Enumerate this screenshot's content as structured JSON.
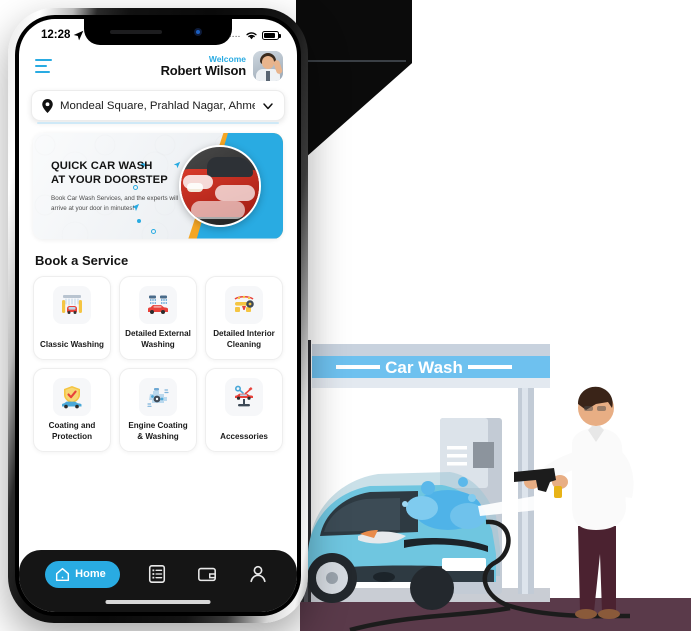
{
  "status_bar": {
    "time": "12:28",
    "location_arrow_icon": "location-arrow-icon",
    "signal_dots": "....",
    "wifi_icon": "wifi-icon",
    "battery_icon": "battery-icon"
  },
  "header": {
    "menu_icon": "hamburger-menu-icon",
    "welcome_label": "Welcome",
    "user_name": "Robert Wilson",
    "avatar_icon": "user-avatar"
  },
  "location": {
    "pin_icon": "map-pin-icon",
    "value": "Mondeal Square, Prahlad Nagar, Ahme...",
    "chevron_icon": "chevron-down-icon"
  },
  "banner": {
    "title_line1": "QUICK CAR WASH",
    "title_line2": "AT YOUR DOORSTEP",
    "subtitle": "Book Car Wash Services, and the experts will arrive at your door in minutes!",
    "photo_icon": "red-car-foam-photo",
    "accent_orange": "#F5A623",
    "accent_blue": "#29ABE2"
  },
  "services": {
    "section_title": "Book a Service",
    "items": [
      {
        "label": "Classic Washing",
        "icon": "car-wash-tunnel-icon"
      },
      {
        "label": "Detailed External Washing",
        "icon": "car-external-wash-icon"
      },
      {
        "label": "Detailed Interior Cleaning",
        "icon": "car-interior-clean-icon"
      },
      {
        "label": "Coating and Protection",
        "icon": "shield-car-protection-icon"
      },
      {
        "label": "Engine Coating & Washing",
        "icon": "engine-gear-icon"
      },
      {
        "label": "Accessories",
        "icon": "car-lift-tools-icon"
      }
    ]
  },
  "bottom_nav": {
    "items": [
      {
        "label": "Home",
        "icon": "home-icon",
        "active": true
      },
      {
        "label": "",
        "icon": "list-checklist-icon",
        "active": false
      },
      {
        "label": "",
        "icon": "wallet-icon",
        "active": false
      },
      {
        "label": "",
        "icon": "person-icon",
        "active": false
      }
    ],
    "active_color": "#29ABE2"
  },
  "background_scene": {
    "sign_text": "Car Wash",
    "sign_color": "#6EC1EF",
    "car_color": "#6FC6E0",
    "ground_color": "#5A3A4A",
    "worker": "man-with-pressure-washer"
  }
}
